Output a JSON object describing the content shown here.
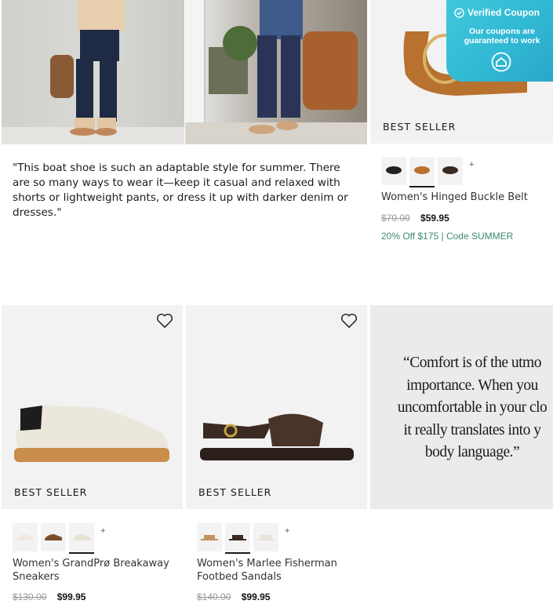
{
  "editorial": {
    "quote": "\"This boat shoe is such an adaptable style for summer. There are so many ways to wear it—keep it casual and relaxed with shorts or lightweight pants, or dress it up with darker denim or dresses.\""
  },
  "coupon": {
    "title": "Verified Coupon",
    "subtitle": "Our coupons are guaranteed to work",
    "check_icon": "check-circle-icon",
    "icon": "house-badge-icon",
    "color": "#32bcd6"
  },
  "products": [
    {
      "badge": "BEST SELLER",
      "name": "Women's Hinged Buckle Belt",
      "price_old": "$70.00",
      "price_new": "$59.95",
      "promo": "20% Off $175 | Code SUMMER",
      "swatches_more": "+"
    },
    {
      "badge": "BEST SELLER",
      "name": "Women's GrandPrø Breakaway Sneakers",
      "price_old": "$130.00",
      "price_new": "$99.95",
      "swatches_more": "+"
    },
    {
      "badge": "BEST SELLER",
      "name": "Women's Marlee Fisherman Footbed Sandals",
      "price_old": "$140.00",
      "price_new": "$99.95",
      "swatches_more": "+"
    }
  ],
  "pull_quote": {
    "lines": [
      "“Comfort is of the utmo",
      "importance. When you",
      "uncomfortable in your clo",
      "it really translates into y",
      "body language.”"
    ]
  },
  "icons": {
    "heart": "heart-icon"
  }
}
